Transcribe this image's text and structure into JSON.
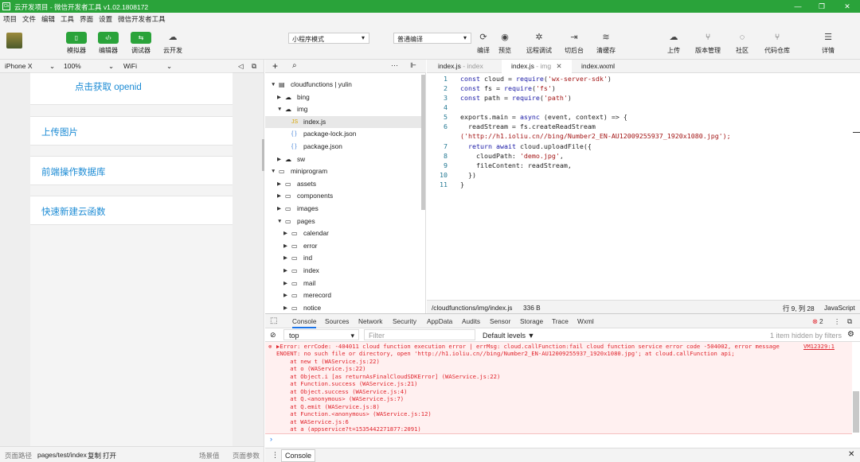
{
  "window": {
    "title": "云开发项目 - 微信开发者工具 v1.02.1808172",
    "icon_text": "Cb"
  },
  "menu": [
    "项目",
    "文件",
    "编辑",
    "工具",
    "界面",
    "设置",
    "微信开发者工具"
  ],
  "toolbar": {
    "simulator": "模拟器",
    "editor": "编辑器",
    "debugger": "调试器",
    "cloud": "云开发",
    "mode_select": "小程序模式",
    "compile_select": "普通编译",
    "compile": "编译",
    "preview": "预览",
    "remote_debug": "远程调试",
    "backend": "切后台",
    "clear_cache": "清缓存",
    "upload": "上传",
    "version": "版本管理",
    "community": "社区",
    "code_repo": "代码仓库",
    "details": "详情"
  },
  "device": {
    "model": "iPhone X",
    "zoom": "100%",
    "network": "WiFi"
  },
  "phone_items": [
    "点击获取 openid",
    "上传图片",
    "前端操作数据库",
    "快速新建云函数"
  ],
  "status": {
    "path_label": "页面路径",
    "path": "pages/test/index",
    "copy": "复制",
    "open": "打开",
    "scene": "场景值",
    "params": "页面参数"
  },
  "tree": [
    {
      "name": "cloudfunctions | yulin",
      "type": "root",
      "open": true
    },
    {
      "name": "bing",
      "type": "cloud",
      "open": false
    },
    {
      "name": "img",
      "type": "cloud",
      "open": true
    },
    {
      "name": "index.js",
      "type": "js"
    },
    {
      "name": "package-lock.json",
      "type": "json"
    },
    {
      "name": "package.json",
      "type": "json"
    },
    {
      "name": "sw",
      "type": "cloud",
      "open": false
    },
    {
      "name": "miniprogram",
      "type": "folder",
      "open": true
    },
    {
      "name": "assets",
      "type": "folder",
      "open": false
    },
    {
      "name": "components",
      "type": "folder",
      "open": false
    },
    {
      "name": "images",
      "type": "folder",
      "open": false
    },
    {
      "name": "pages",
      "type": "folder",
      "open": true
    },
    {
      "name": "calendar",
      "type": "folder",
      "open": false
    },
    {
      "name": "error",
      "type": "folder",
      "open": false
    },
    {
      "name": "ind",
      "type": "folder",
      "open": false
    },
    {
      "name": "index",
      "type": "folder",
      "open": false
    },
    {
      "name": "mail",
      "type": "folder",
      "open": false
    },
    {
      "name": "merecord",
      "type": "folder",
      "open": false
    },
    {
      "name": "notice",
      "type": "folder",
      "open": false
    }
  ],
  "tabs": [
    {
      "name": "index.js",
      "hint": "- index"
    },
    {
      "name": "index.js",
      "hint": "- img"
    },
    {
      "name": "index.wxml",
      "hint": ""
    }
  ],
  "code": [
    "const cloud = require('wx-server-sdk')",
    "const fs = require('fs')",
    "const path = require('path')",
    "",
    "exports.main = async (event, context) => {",
    "  readStream = fs.createReadStream",
    "  return await cloud.uploadFile({",
    "    cloudPath: 'demo.jpg',",
    "    fileContent: readStream,",
    "  })",
    "}"
  ],
  "code_wrap": "('http://h1.ioliu.cn//bing/Number2_EN-AU12009255937_1920x1080.jpg');",
  "editor_status": {
    "file": "/cloudfunctions/img/index.js",
    "size": "336 B",
    "cursor": "行 9, 列 28",
    "lang": "JavaScript"
  },
  "devtools_tabs": [
    "Console",
    "Sources",
    "Network",
    "Security",
    "AppData",
    "Audits",
    "Sensor",
    "Storage",
    "Trace",
    "Wxml"
  ],
  "error_count": "2",
  "filter": {
    "context": "top",
    "placeholder": "Filter",
    "levels": "Default levels ▼",
    "hidden": "1 item hidden by filters"
  },
  "console": [
    "▶Error: errCode: -404011 cloud function execution error | errMsg: cloud.callFunction:fail cloud function service error code -504002, error message",
    "ENOENT: no such file or directory, open 'http://h1.ioliu.cn//bing/Number2_EN-AU12009255937_1920x1080.jpg'; at cloud.callFunction api;",
    "    at new t (WAService.js:22)",
    "    at o (WAService.js:22)",
    "    at Object.i [as returnAsFinalCloudSDKError] (WAService.js:22)",
    "    at Function.success (WAService.js:21)",
    "    at Object.success (WAService.js:4)",
    "    at Q.<anonymous> (WAService.js:7)",
    "    at Q.emit (WAService.js:8)",
    "    at Function.<anonymous> (WAService.js:12)",
    "    at WAService.js:6",
    "    at a (appservice?t=1535442271877:2091)"
  ],
  "console_link": "VM12329:1",
  "drawer_tab": "Console"
}
